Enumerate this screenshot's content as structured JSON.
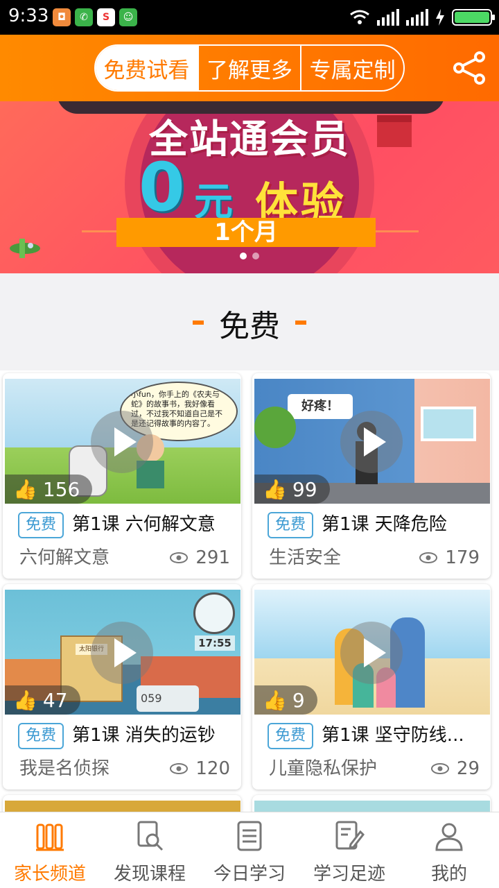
{
  "status_bar": {
    "time": "9:33"
  },
  "header": {
    "tabs": [
      {
        "label": "免费试看",
        "active": true
      },
      {
        "label": "了解更多",
        "active": false
      },
      {
        "label": "专属定制",
        "active": false
      }
    ],
    "share_icon": "share-icon"
  },
  "banner": {
    "title": "全站通会员",
    "zero": "0",
    "yuan": "元",
    "experience": "体验",
    "duration": "1个月",
    "dots": 2,
    "active_dot": 0
  },
  "section": {
    "title": "免费"
  },
  "cards": [
    {
      "tag": "免费",
      "title": "第1课 六何解文意",
      "category": "六何解文意",
      "likes": "156",
      "views": "291",
      "bubble": "小fun，你手上的《农夫与蛇》的故事书，我好像看过，不过我不知道自己是不是还记得故事的内容了。"
    },
    {
      "tag": "免费",
      "title": "第1课 天降危险",
      "category": "生活安全",
      "likes": "99",
      "views": "179",
      "bubble": "好疼！"
    },
    {
      "tag": "免费",
      "title": "第1课 消失的运钞",
      "category": "我是名侦探",
      "likes": "47",
      "views": "120",
      "clock": "17:55",
      "plate": "059",
      "sign": "太阳银行"
    },
    {
      "tag": "免费",
      "title": "第1课 坚守防线...",
      "category": "儿童隐私保护",
      "likes": "9",
      "views": "29"
    }
  ],
  "nav": [
    {
      "label": "家长频道",
      "icon": "books-icon",
      "active": true
    },
    {
      "label": "发现课程",
      "icon": "search-doc-icon",
      "active": false
    },
    {
      "label": "今日学习",
      "icon": "notebook-icon",
      "active": false
    },
    {
      "label": "学习足迹",
      "icon": "edit-doc-icon",
      "active": false
    },
    {
      "label": "我的",
      "icon": "person-icon",
      "active": false
    }
  ],
  "colors": {
    "accent": "#ff7a00",
    "tag_blue": "#3c9ad2"
  }
}
